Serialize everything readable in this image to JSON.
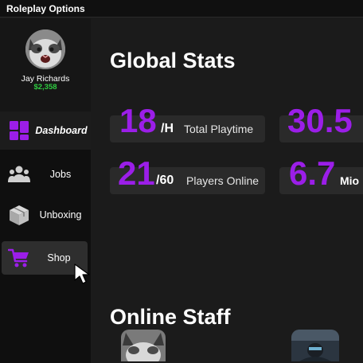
{
  "window": {
    "title": "Roleplay Options"
  },
  "profile": {
    "name": "Jay Richards",
    "money": "$2,358"
  },
  "nav": {
    "items": [
      {
        "label": "Dashboard",
        "icon": "dashboard-icon"
      },
      {
        "label": "Jobs",
        "icon": "people-icon"
      },
      {
        "label": "Unboxing",
        "icon": "box-icon"
      },
      {
        "label": "Shop",
        "icon": "cart-icon"
      }
    ]
  },
  "main": {
    "global_title": "Global Stats",
    "stats": [
      {
        "value": "18",
        "unit": "/H",
        "label": "Total Playtime"
      },
      {
        "value": "30.5",
        "unit": "",
        "label": ""
      },
      {
        "value": "21",
        "unit": "/60",
        "label": "Players Online"
      },
      {
        "value": "6.7",
        "unit": "Mio",
        "label": ""
      }
    ],
    "staff_title": "Online Staff"
  },
  "colors": {
    "accent": "#9b1ee8",
    "money": "#2ecc40",
    "sidebar_bg": "#0f0f0f",
    "main_bg": "#1b1b1b"
  }
}
